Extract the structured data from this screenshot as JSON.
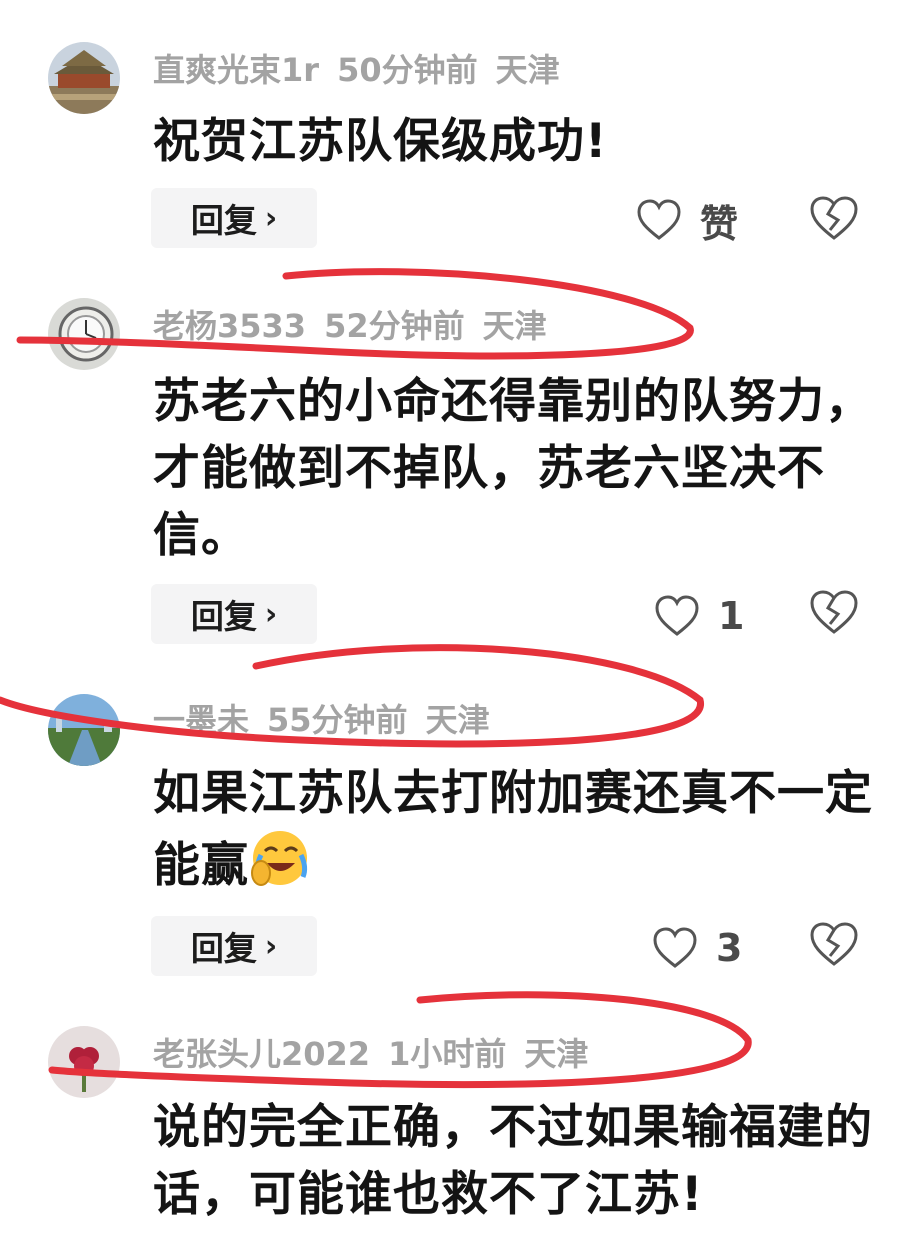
{
  "comments": [
    {
      "username": "直爽光束1r",
      "time": "50分钟前",
      "location": "天津",
      "text": "祝贺江苏队保级成功!",
      "reply_label": "回复",
      "reply_chevron": "›",
      "like_label": "赞"
    },
    {
      "username": "老杨3533",
      "time": "52分钟前",
      "location": "天津",
      "text": "苏老六的小命还得靠别的队努力，才能做到不掉队，苏老六坚决不信。",
      "reply_label": "回复",
      "reply_chevron": "›",
      "like_count": "1"
    },
    {
      "username": "一墨未",
      "time": "55分钟前",
      "location": "天津",
      "text": "如果江苏队去打附加赛还真不一定能赢",
      "emoji": "face-holding-back-tears-laughing",
      "reply_label": "回复",
      "reply_chevron": "›",
      "like_count": "3"
    },
    {
      "username": "老张头儿2022",
      "time": "1小时前",
      "location": "天津",
      "text": "说的完全正确，不过如果输福建的话，可能谁也救不了江苏!"
    }
  ],
  "icons": {
    "like": "heart-outline-icon",
    "dislike": "broken-heart-icon",
    "chevron": "chevron-right-icon"
  },
  "colors": {
    "meta_text": "#a3a3a3",
    "body_text": "#141414",
    "reply_bg": "#f4f4f5",
    "annotation_stroke": "#e5323b"
  }
}
